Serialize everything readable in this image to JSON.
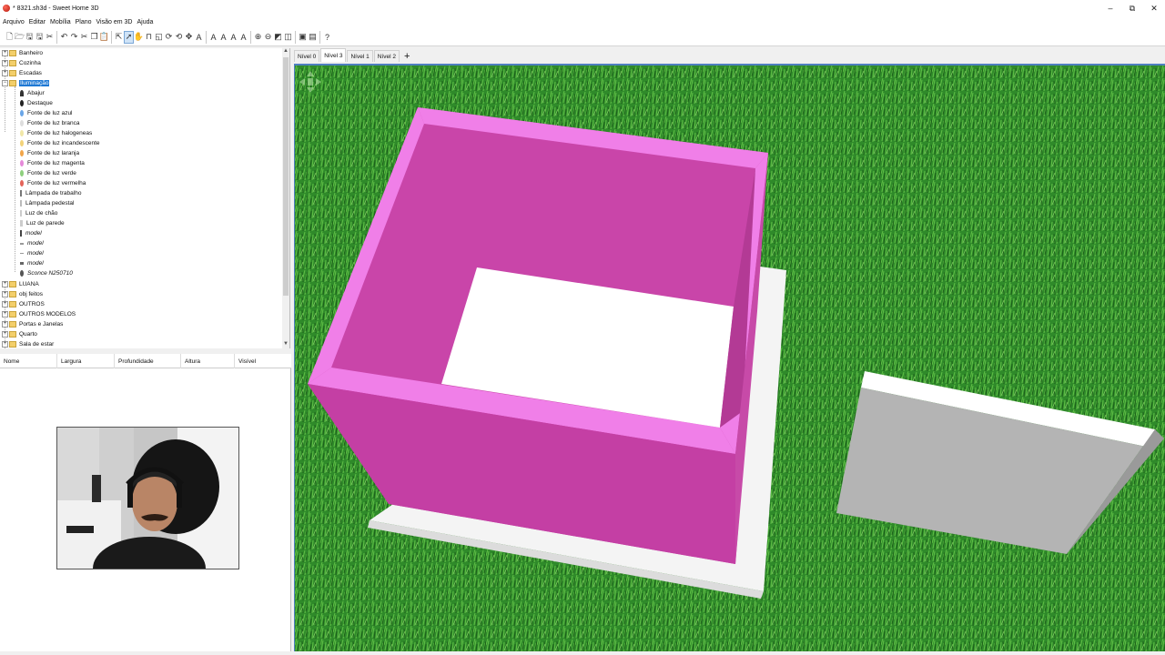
{
  "window": {
    "title": "* 8321.sh3d - Sweet Home 3D",
    "minimize": "–",
    "maximize": "⧉",
    "close": "✕"
  },
  "menu": [
    "Arquivo",
    "Editar",
    "Mobília",
    "Plano",
    "Visão em 3D",
    "Ajuda"
  ],
  "catalog": {
    "categories_top": [
      "Banheiro",
      "Cozinha",
      "Escadas"
    ],
    "selected_category": "Iluminação",
    "items": [
      {
        "label": "Abajur",
        "italic": false
      },
      {
        "label": "Destaque",
        "italic": false
      },
      {
        "label": "Fonte de luz azul",
        "italic": false
      },
      {
        "label": "Fonte de luz branca",
        "italic": false
      },
      {
        "label": "Fonte de luz halogeneas",
        "italic": false
      },
      {
        "label": "Fonte de luz incandescente",
        "italic": false
      },
      {
        "label": "Fonte de luz laranja",
        "italic": false
      },
      {
        "label": "Fonte de luz magenta",
        "italic": false
      },
      {
        "label": "Fonte de luz verde",
        "italic": false
      },
      {
        "label": "Fonte de luz vermelha",
        "italic": false
      },
      {
        "label": "Lâmpada de trabalho",
        "italic": false
      },
      {
        "label": "Lâmpada pedestal",
        "italic": false
      },
      {
        "label": "Luz de chão",
        "italic": false
      },
      {
        "label": "Luz de parede",
        "italic": false
      },
      {
        "label": "model",
        "italic": true
      },
      {
        "label": "model",
        "italic": true
      },
      {
        "label": "model",
        "italic": true
      },
      {
        "label": "model",
        "italic": true
      },
      {
        "label": "Sconce N250710",
        "italic": true
      }
    ],
    "categories_bottom": [
      "LUANA",
      "obj feitos",
      "OUTROS",
      "OUTROS MODELOS",
      "Portas e Janelas",
      "Quarto",
      "Sala de estar"
    ]
  },
  "furniture_table": {
    "columns": [
      "Nome",
      "Largura",
      "Profundidade",
      "Altura",
      "Visível"
    ]
  },
  "levels": {
    "tabs": [
      "Nível 0",
      "Nível 3",
      "Nível 1",
      "Nível 2"
    ],
    "active": "Nível 3",
    "add": "+"
  },
  "colors": {
    "box_inner": "#c945a9",
    "box_rim": "#f07fe8",
    "grass": "#2f8a2a",
    "slab": "#f4f4f4",
    "panel": "#b4b4b4"
  }
}
